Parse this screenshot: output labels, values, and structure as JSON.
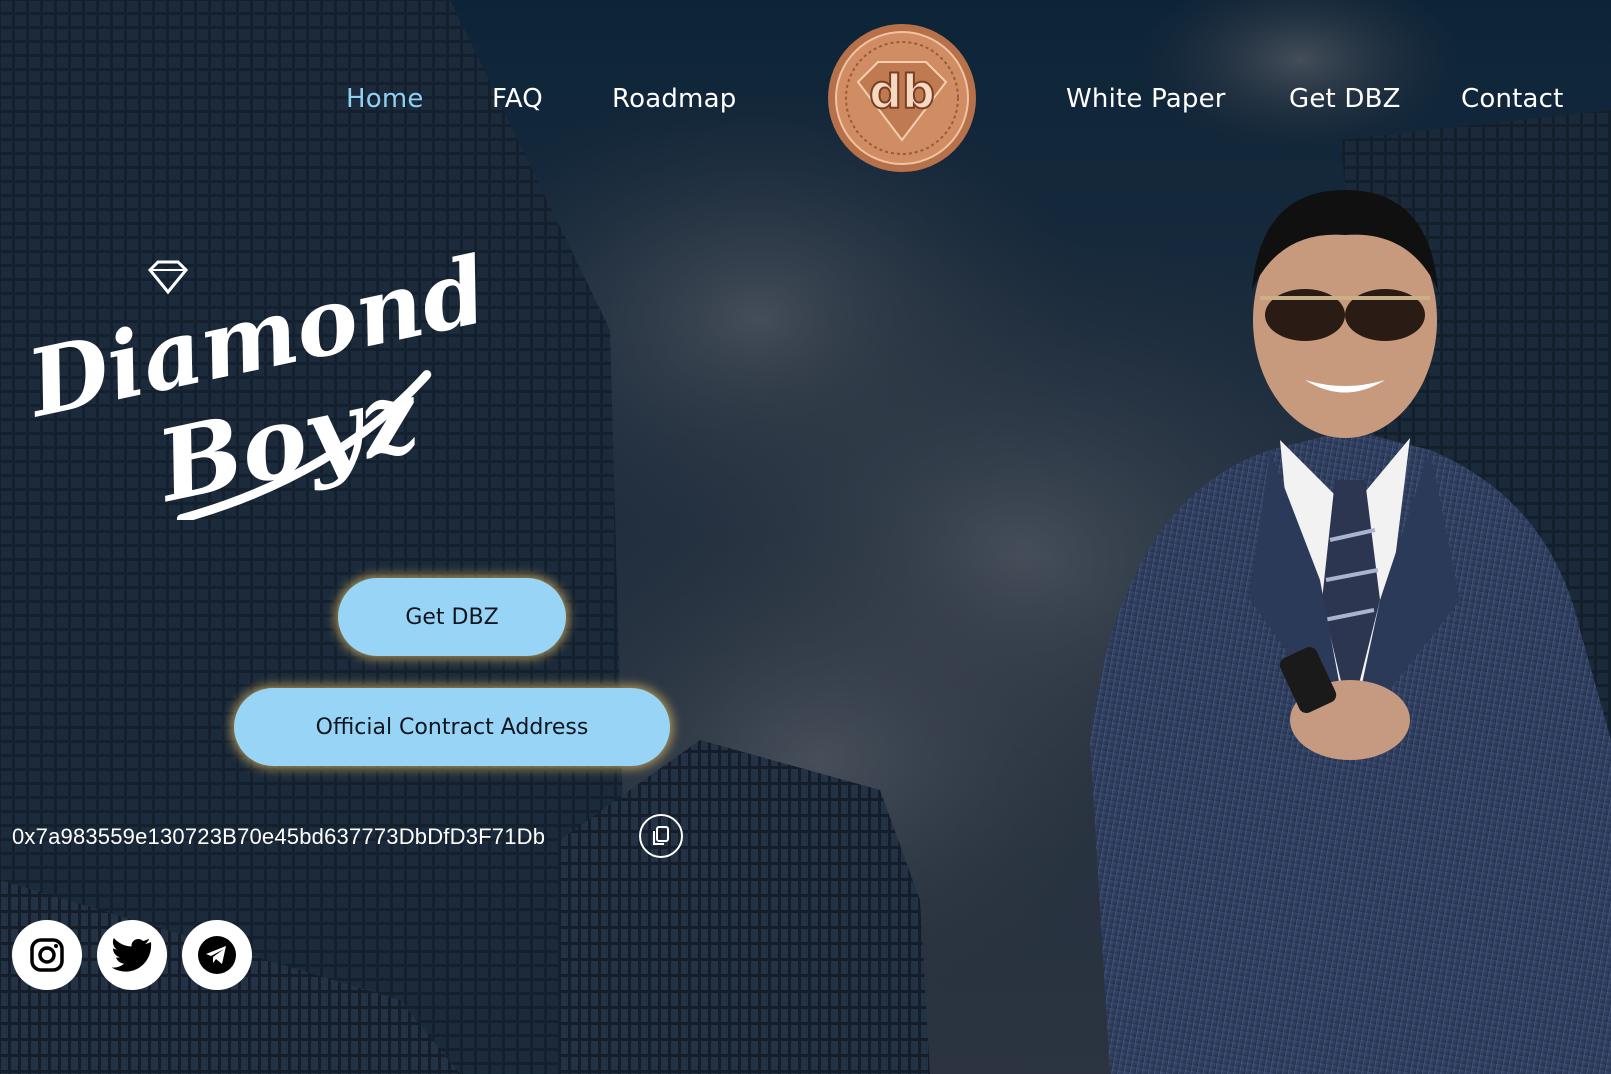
{
  "nav": {
    "left": [
      {
        "label": "Home",
        "active": true
      },
      {
        "label": "FAQ",
        "active": false
      },
      {
        "label": "Roadmap",
        "active": false
      }
    ],
    "right": [
      {
        "label": "White Paper",
        "active": false
      },
      {
        "label": "Get DBZ",
        "active": false
      },
      {
        "label": "Contact",
        "active": false
      }
    ],
    "logo_text": "db"
  },
  "hero": {
    "brand_line1": "Diamond",
    "brand_line2": "Boyz",
    "get_button": "Get DBZ",
    "contract_button": "Official Contract Address",
    "contract_address": "0x7a983559e130723B70e45bd637773DbDfD3F71Db"
  },
  "social": [
    {
      "icon": "instagram-icon"
    },
    {
      "icon": "twitter-icon"
    },
    {
      "icon": "telegram-icon"
    }
  ],
  "colors": {
    "accent": "#97d4f5",
    "active_nav": "#8fd0f3",
    "coin": "#c88457",
    "sky": "#0f2438"
  }
}
